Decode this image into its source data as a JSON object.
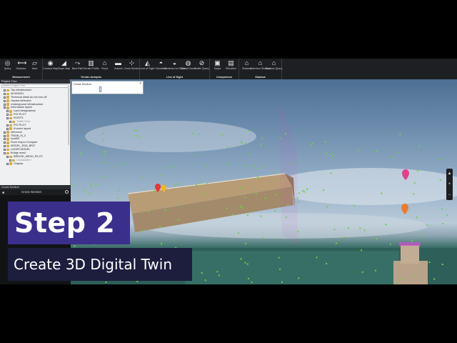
{
  "ribbon": {
    "groups": [
      {
        "label": "Measurement",
        "buttons": [
          {
            "icon": "query-icon",
            "label": "Query"
          },
          {
            "icon": "distance-icon",
            "label": "Distance"
          },
          {
            "icon": "area-icon",
            "label": "Area"
          }
        ]
      },
      {
        "label": "Terrain Analysis",
        "buttons": [
          {
            "icon": "contour-map-icon",
            "label": "Contour Map"
          },
          {
            "icon": "slope-map-icon",
            "label": "Slope Map"
          },
          {
            "icon": "best-path-icon",
            "label": "Best Path"
          },
          {
            "icon": "terrain-profile-icon",
            "label": "Terrain Profile"
          },
          {
            "icon": "flood-icon",
            "label": "Flood"
          },
          {
            "icon": "volume-icon",
            "label": "Volume"
          },
          {
            "icon": "cross-section-icon",
            "label": "Cross Section"
          }
        ]
      },
      {
        "label": "Line of Sight",
        "buttons": [
          {
            "icon": "line-of-sight-icon",
            "label": "Line of Sight"
          },
          {
            "icon": "viewshed-icon",
            "label": "Viewshed"
          },
          {
            "icon": "viewshed-on-route-icon",
            "label": "Viewshed on Route"
          },
          {
            "icon": "threat-dome-icon",
            "label": "Threat Dome"
          },
          {
            "icon": "buffer-query-icon",
            "label": "Buffer Query"
          }
        ]
      },
      {
        "label": "Comparison",
        "buttons": [
          {
            "icon": "swipe-icon",
            "label": "Swipe"
          },
          {
            "icon": "elevation-icon",
            "label": "Elevation"
          }
        ]
      },
      {
        "label": "Shadow",
        "buttons": [
          {
            "icon": "shadow-icon",
            "label": "Shadow"
          },
          {
            "icon": "selection-shadow-icon",
            "label": "Selection Shadow"
          },
          {
            "icon": "shadow-query-icon",
            "label": "Shadow Query"
          }
        ]
      }
    ]
  },
  "project_tree": {
    "title": "Project Tree",
    "search_placeholder": "Search Project Tree",
    "items": [
      {
        "label": "Top infrastructure",
        "indent": 1
      },
      {
        "label": "3d MODEL",
        "indent": 1
      },
      {
        "label": "Technical detail do not turn off",
        "indent": 1
      },
      {
        "label": "Hazard detection",
        "indent": 1
      },
      {
        "label": "Underground infrastructure",
        "indent": 1
      },
      {
        "label": "Information layers",
        "indent": 1
      },
      {
        "label": "Land designations",
        "indent": 2
      },
      {
        "label": "POI PLOT",
        "indent": 2
      },
      {
        "label": "ROOTS",
        "indent": 2
      },
      {
        "label": "Traffic Post",
        "indent": 3
      },
      {
        "label": "POI PLOT",
        "indent": 2
      },
      {
        "label": "Erosion layout",
        "indent": 2
      },
      {
        "label": "reference",
        "indent": 1
      },
      {
        "label": "TRAIN_M_3",
        "indent": 1
      },
      {
        "label": "local60",
        "indent": 1
      },
      {
        "label": "Rock Hoyon Compare",
        "indent": 1
      },
      {
        "label": "MODEL_END_BRIT",
        "indent": 1
      },
      {
        "label": "LAGER MODEL",
        "indent": 1
      },
      {
        "label": "Bridge mesh",
        "indent": 1
      },
      {
        "label": "BRIDGE_MESH_PILOT",
        "indent": 2
      },
      {
        "label": "Unclassified",
        "indent": 3
      },
      {
        "label": "Outputs",
        "indent": 2
      }
    ]
  },
  "cross_section_panel": {
    "header": "Cross Section",
    "tab_label": "Cross Section"
  },
  "cross_section_window": {
    "title": "Cross Section"
  },
  "nav": [
    "▲",
    "+",
    "−"
  ],
  "overlay": {
    "step": "Step 2",
    "subtitle": "Create 3D Digital Twin"
  },
  "colors": {
    "step_bg": "#3b2f8c",
    "subtitle_bg": "#1d1e3e",
    "section_plane": "#d44fd1",
    "point_markers": "#6fcf4a",
    "pin_pink": "#e0418b",
    "pin_orange": "#f07a2a"
  }
}
